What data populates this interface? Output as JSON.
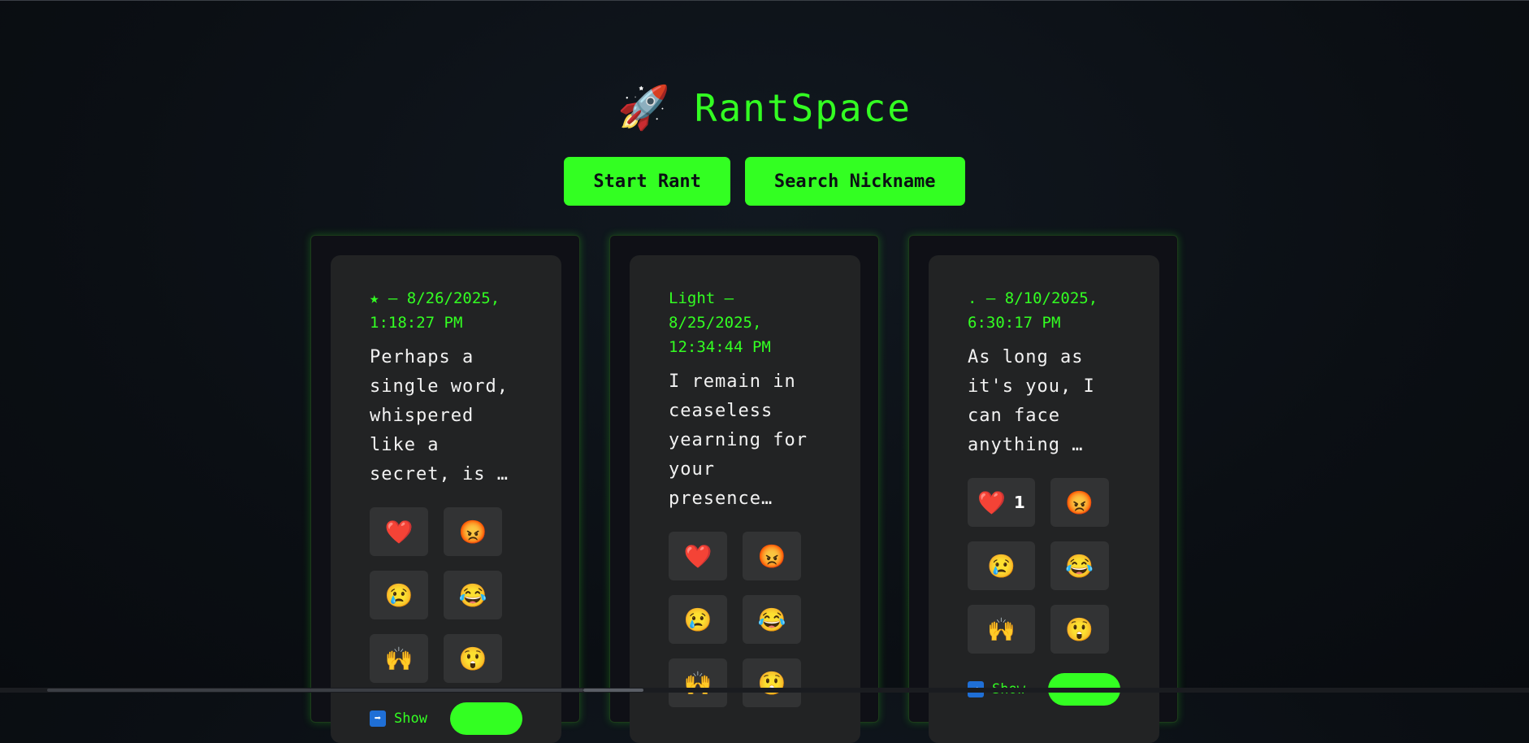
{
  "app": {
    "title": "RantSpace",
    "logo_icon": "🚀"
  },
  "toolbar": {
    "start_rant_label": "Start Rant",
    "search_nickname_label": "Search Nickname"
  },
  "colors": {
    "accent": "#33ff22",
    "background": "#0b0f14",
    "card": "#222324",
    "reaction_button": "#323334"
  },
  "rants": [
    {
      "meta": "★ – 8/26/2025, 1:18:27 PM",
      "text": "Perhaps a single word, whispered like a secret, is …",
      "reactions": [
        {
          "icon": "❤️",
          "name": "heart-icon",
          "count": ""
        },
        {
          "icon": "😡",
          "name": "angry-face-icon",
          "count": ""
        },
        {
          "icon": "😢",
          "name": "crying-face-icon",
          "count": ""
        },
        {
          "icon": "😂",
          "name": "laughing-face-icon",
          "count": ""
        },
        {
          "icon": "🙌",
          "name": "raised-hands-icon",
          "count": ""
        },
        {
          "icon": "😲",
          "name": "surprised-face-icon",
          "count": ""
        }
      ],
      "show_label": "Show",
      "show_icon": "➡"
    },
    {
      "meta": "Light – 8/25/2025, 12:34:44 PM",
      "text": "I remain in ceaseless yearning for your presence…",
      "reactions": [
        {
          "icon": "❤️",
          "name": "heart-icon",
          "count": ""
        },
        {
          "icon": "😡",
          "name": "angry-face-icon",
          "count": ""
        },
        {
          "icon": "😢",
          "name": "crying-face-icon",
          "count": ""
        },
        {
          "icon": "😂",
          "name": "laughing-face-icon",
          "count": ""
        },
        {
          "icon": "🙌",
          "name": "raised-hands-icon",
          "count": ""
        },
        {
          "icon": "😲",
          "name": "surprised-face-icon",
          "count": ""
        }
      ],
      "show_label": "",
      "show_icon": ""
    },
    {
      "meta": ". – 8/10/2025, 6:30:17 PM",
      "text": "As long as it's you, I can face anything …",
      "reactions": [
        {
          "icon": "❤️",
          "name": "heart-icon",
          "count": "1"
        },
        {
          "icon": "😡",
          "name": "angry-face-icon",
          "count": ""
        },
        {
          "icon": "😢",
          "name": "crying-face-icon",
          "count": ""
        },
        {
          "icon": "😂",
          "name": "laughing-face-icon",
          "count": ""
        },
        {
          "icon": "🙌",
          "name": "raised-hands-icon",
          "count": ""
        },
        {
          "icon": "😲",
          "name": "surprised-face-icon",
          "count": ""
        }
      ],
      "show_label": "Show",
      "show_icon": "➡"
    }
  ]
}
